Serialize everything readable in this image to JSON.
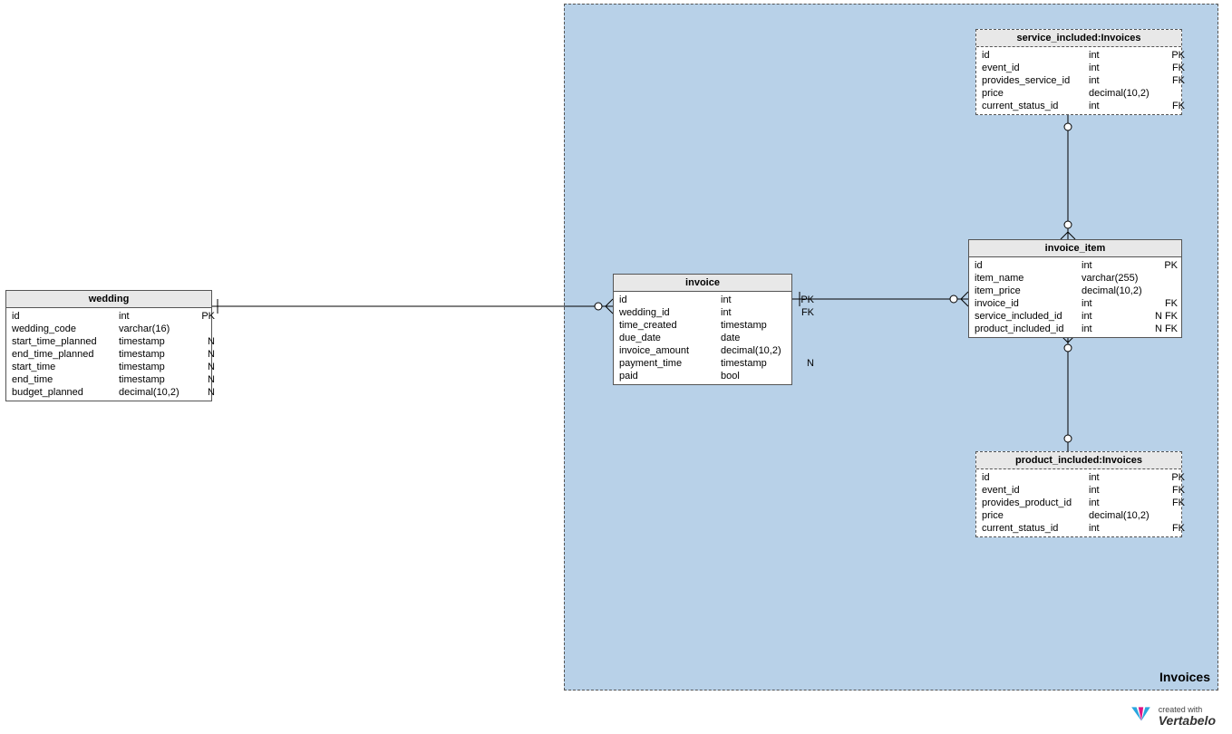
{
  "region": {
    "label": "Invoices"
  },
  "entities": {
    "wedding": {
      "title": "wedding",
      "rows": [
        {
          "name": "id",
          "type": "int",
          "key": "PK"
        },
        {
          "name": "wedding_code",
          "type": "varchar(16)",
          "key": ""
        },
        {
          "name": "start_time_planned",
          "type": "timestamp",
          "key": "N"
        },
        {
          "name": "end_time_planned",
          "type": "timestamp",
          "key": "N"
        },
        {
          "name": "start_time",
          "type": "timestamp",
          "key": "N"
        },
        {
          "name": "end_time",
          "type": "timestamp",
          "key": "N"
        },
        {
          "name": "budget_planned",
          "type": "decimal(10,2)",
          "key": "N"
        }
      ]
    },
    "invoice": {
      "title": "invoice",
      "rows": [
        {
          "name": "id",
          "type": "int",
          "key": "PK"
        },
        {
          "name": "wedding_id",
          "type": "int",
          "key": "FK"
        },
        {
          "name": "time_created",
          "type": "timestamp",
          "key": ""
        },
        {
          "name": "due_date",
          "type": "date",
          "key": ""
        },
        {
          "name": "invoice_amount",
          "type": "decimal(10,2)",
          "key": ""
        },
        {
          "name": "payment_time",
          "type": "timestamp",
          "key": "N"
        },
        {
          "name": "paid",
          "type": "bool",
          "key": ""
        }
      ]
    },
    "service_included": {
      "title": "service_included:Invoices",
      "rows": [
        {
          "name": "id",
          "type": "int",
          "key": "PK"
        },
        {
          "name": "event_id",
          "type": "int",
          "key": "FK"
        },
        {
          "name": "provides_service_id",
          "type": "int",
          "key": "FK"
        },
        {
          "name": "price",
          "type": "decimal(10,2)",
          "key": ""
        },
        {
          "name": "current_status_id",
          "type": "int",
          "key": "FK"
        }
      ]
    },
    "invoice_item": {
      "title": "invoice_item",
      "rows": [
        {
          "name": "id",
          "type": "int",
          "key": "PK"
        },
        {
          "name": "item_name",
          "type": "varchar(255)",
          "key": ""
        },
        {
          "name": "item_price",
          "type": "decimal(10,2)",
          "key": ""
        },
        {
          "name": "invoice_id",
          "type": "int",
          "key": "FK"
        },
        {
          "name": "service_included_id",
          "type": "int",
          "key": "N FK"
        },
        {
          "name": "product_included_id",
          "type": "int",
          "key": "N FK"
        }
      ]
    },
    "product_included": {
      "title": "product_included:Invoices",
      "rows": [
        {
          "name": "id",
          "type": "int",
          "key": "PK"
        },
        {
          "name": "event_id",
          "type": "int",
          "key": "FK"
        },
        {
          "name": "provides_product_id",
          "type": "int",
          "key": "FK"
        },
        {
          "name": "price",
          "type": "decimal(10,2)",
          "key": ""
        },
        {
          "name": "current_status_id",
          "type": "int",
          "key": "FK"
        }
      ]
    }
  },
  "logo": {
    "created_with": "created with",
    "brand": "Vertabelo"
  }
}
